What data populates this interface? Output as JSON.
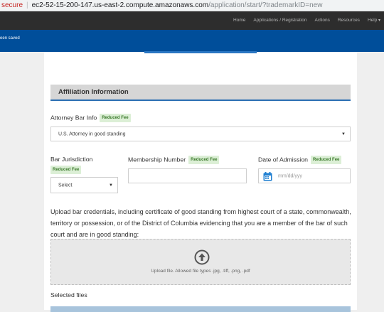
{
  "browser": {
    "security": "secure",
    "url_host": "ec2-52-15-200-147.us-east-2.compute.amazonaws.com",
    "url_path": "/application/start/?trademarkID=new"
  },
  "nav": {
    "items": [
      "Home",
      "Applications / Registration",
      "Actions",
      "Resources",
      "Help"
    ]
  },
  "banner": {
    "message": "een saved"
  },
  "section": {
    "title": "Affiliation Information"
  },
  "fee_badge": "Reduced Fee",
  "attorney_bar_info": {
    "label": "Attorney Bar Info",
    "value": "U.S. Attorney in good standing"
  },
  "bar_jurisdiction": {
    "label": "Bar Jurisdiction",
    "value": "Select"
  },
  "membership_number": {
    "label": "Membership Number",
    "value": ""
  },
  "date_of_admission": {
    "label": "Date of Admission",
    "placeholder": "mm/dd/yyy"
  },
  "upload": {
    "instructions": "Upload bar credentials, including certificate of good standing from highest court of a state, commonwealth, territory or possession, or of the District of Columbia evidencing that you are a member of the bar of such court and are in good standing:",
    "hint": "Upload file. Allowed file types .jpg, .tiff, .png, .pdf"
  },
  "selected_files": {
    "label": "Selected files"
  },
  "colors": {
    "nav_bg": "#2d2d2d",
    "banner_bg": "#004e9a",
    "accent": "#2b6fb3",
    "badge_bg": "#dcefd6",
    "badge_text": "#3b7a2b",
    "calendar": "#1f7fd1"
  },
  "icons": {
    "calendar": "calendar-icon",
    "upload": "upload-arrow-icon",
    "dropdown": "chevron-down-icon"
  }
}
